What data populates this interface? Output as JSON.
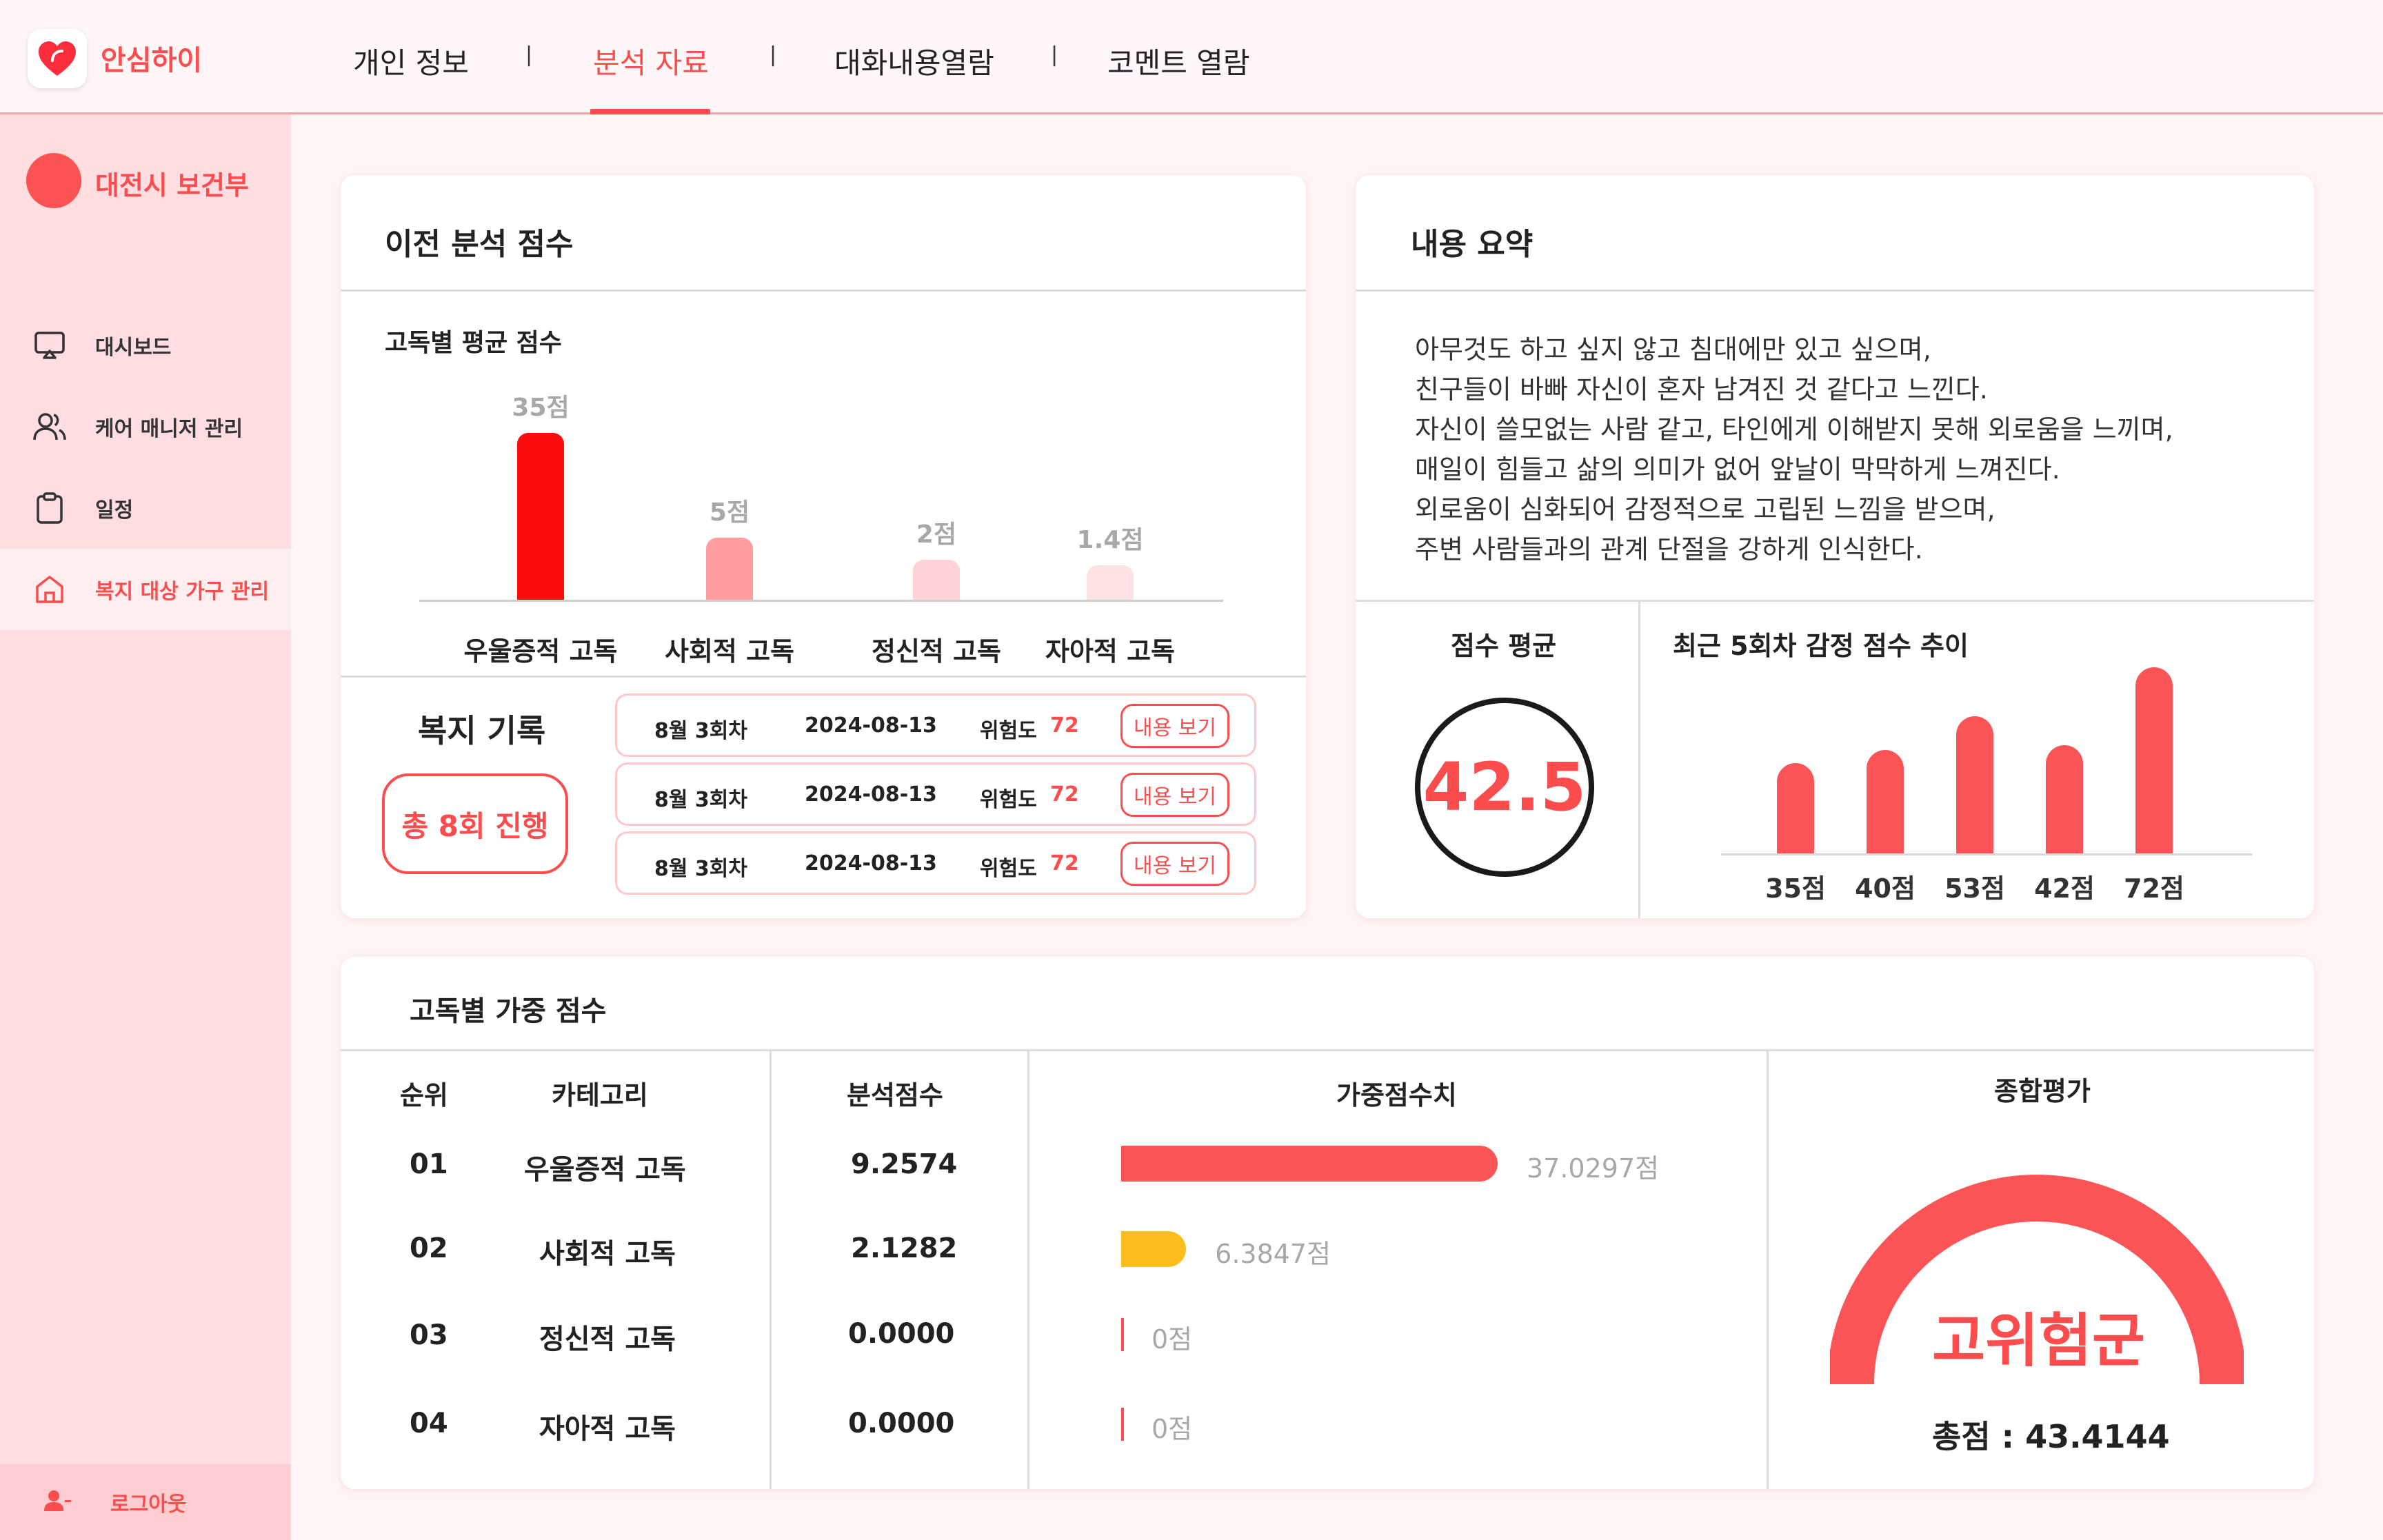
{
  "brand": "안심하이",
  "nav": [
    {
      "label": "개인 정보"
    },
    {
      "label": "분석 자료"
    },
    {
      "label": "대화내용열람"
    },
    {
      "label": "코멘트 열람"
    }
  ],
  "nav_sep": "|",
  "sidebar": {
    "org": "대전시 보건부",
    "items": [
      {
        "label": "대시보드"
      },
      {
        "label": "케어 매니저 관리"
      },
      {
        "label": "일정"
      },
      {
        "label": "복지 대상 가구 관리"
      }
    ],
    "logout": "로그아웃"
  },
  "prev_scores": {
    "title": "이전 분석 점수",
    "subtitle": "고독별 평균 점수"
  },
  "chart_data": [
    {
      "type": "bar",
      "title": "고독별 평균 점수",
      "categories": [
        "우울증적 고독",
        "사회적 고독",
        "정신적 고독",
        "자아적 고독"
      ],
      "values": [
        35,
        5,
        2,
        1.4
      ],
      "value_labels": [
        "35점",
        "5점",
        "2점",
        "1.4점"
      ],
      "colors": [
        "#fb0d0d",
        "#ff9d9f",
        "#ffd3d5",
        "#ffe2e3"
      ]
    },
    {
      "type": "bar",
      "title": "최근 5회차 감정 점수 추이",
      "categories": [
        "35점",
        "40점",
        "53점",
        "42점",
        "72점"
      ],
      "values": [
        35,
        40,
        53,
        42,
        72
      ],
      "colors": [
        "#fb5457"
      ]
    },
    {
      "type": "bar",
      "title": "가중점수치",
      "categories": [
        "우울증적 고독",
        "사회적 고독",
        "정신적 고독",
        "자아적 고독"
      ],
      "values": [
        37.0297,
        6.3847,
        0,
        0
      ],
      "value_labels": [
        "37.0297점",
        "6.3847점",
        "0점",
        "0점"
      ],
      "colors": [
        "#fb5457",
        "#fcbd1f"
      ]
    }
  ],
  "welfare": {
    "title": "복지 기록",
    "total": "총 8회 진행",
    "records": [
      {
        "round": "8월 3회차",
        "date": "2024-08-13",
        "risk_label": "위험도",
        "risk": "72",
        "button": "내용 보기"
      },
      {
        "round": "8월 3회차",
        "date": "2024-08-13",
        "risk_label": "위험도",
        "risk": "72",
        "button": "내용 보기"
      },
      {
        "round": "8월 3회차",
        "date": "2024-08-13",
        "risk_label": "위험도",
        "risk": "72",
        "button": "내용 보기"
      }
    ]
  },
  "summary": {
    "title": "내용 요약",
    "lines": [
      "아무것도 하고 싶지 않고 침대에만 있고 싶으며,",
      "친구들이 바빠 자신이 혼자 남겨진 것 같다고 느낀다.",
      "자신이 쓸모없는 사람 같고, 타인에게 이해받지 못해 외로움을 느끼며,",
      "매일이 힘들고 삶의 의미가 없어 앞날이 막막하게 느껴진다.",
      "외로움이 심화되어 감정적으로 고립된 느낌을 받으며,",
      "주변 사람들과의 관계 단절을 강하게 인식한다."
    ],
    "avg_title": "점수 평균",
    "avg_value": "42.5",
    "trend_title": "최근 5회차 감정 점수 추이"
  },
  "weighted": {
    "title": "고독별 가중 점수",
    "headers": {
      "rank": "순위",
      "category": "카테고리",
      "score": "분석점수",
      "weighted": "가중점수치",
      "eval": "종합평가"
    },
    "rows": [
      {
        "rank": "01",
        "category": "우울증적 고독",
        "score": "9.2574",
        "weighted": "37.0297점"
      },
      {
        "rank": "02",
        "category": "사회적 고독",
        "score": "2.1282",
        "weighted": "6.3847점"
      },
      {
        "rank": "03",
        "category": "정신적 고독",
        "score": "0.0000",
        "weighted": "0점"
      },
      {
        "rank": "04",
        "category": "자아적 고독",
        "score": "0.0000",
        "weighted": "0점"
      }
    ],
    "eval_label": "고위험군",
    "eval_total": "총점 : 43.4144"
  },
  "colors": {
    "accent": "#fb4d4d",
    "sidebar_bg": "#ffdde0",
    "page_bg": "#fff5f5",
    "bar_yellow": "#fcbd1f"
  }
}
